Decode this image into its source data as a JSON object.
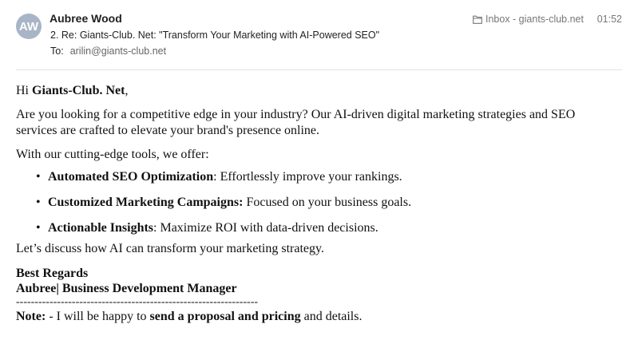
{
  "header": {
    "avatar_initials": "AW",
    "sender_name": "Aubree Wood",
    "subject": "2. Re: Giants-Club. Net: \"Transform Your Marketing with AI-Powered SEO\"",
    "to_label": "To:",
    "to_address": "arilin@giants-club.net",
    "mailbox": "Inbox - giants-club.net",
    "mailbox_icon": "folder-icon",
    "time": "01:52",
    "avatar_color": "#a8b5c6"
  },
  "email": {
    "greeting_prefix": "Hi ",
    "greeting_name": "Giants-Club. Net",
    "greeting_suffix": ",",
    "intro": "Are you looking for a competitive edge in your industry? Our AI-driven digital marketing strategies and SEO services are crafted to elevate your brand's presence online.",
    "offer_lead": "With our cutting-edge tools, we offer:",
    "features": [
      {
        "title": "Automated SEO Optimization",
        "text": ": Effortlessly improve your rankings."
      },
      {
        "title": "Customized Marketing Campaigns:",
        "text": " Focused on your business goals."
      },
      {
        "title": "Actionable Insights",
        "text": ": Maximize ROI with data-driven decisions."
      }
    ],
    "closing": "Let’s discuss how AI can transform your marketing strategy.",
    "sign_off": "Best Regards",
    "signature": "Aubree| Business Development Manager",
    "rule": "-----------------------------------------------------------------",
    "note_label": "Note:",
    "note_pre": " - I will be happy to ",
    "note_bold": "send a proposal and pricing",
    "note_post": " and details."
  }
}
